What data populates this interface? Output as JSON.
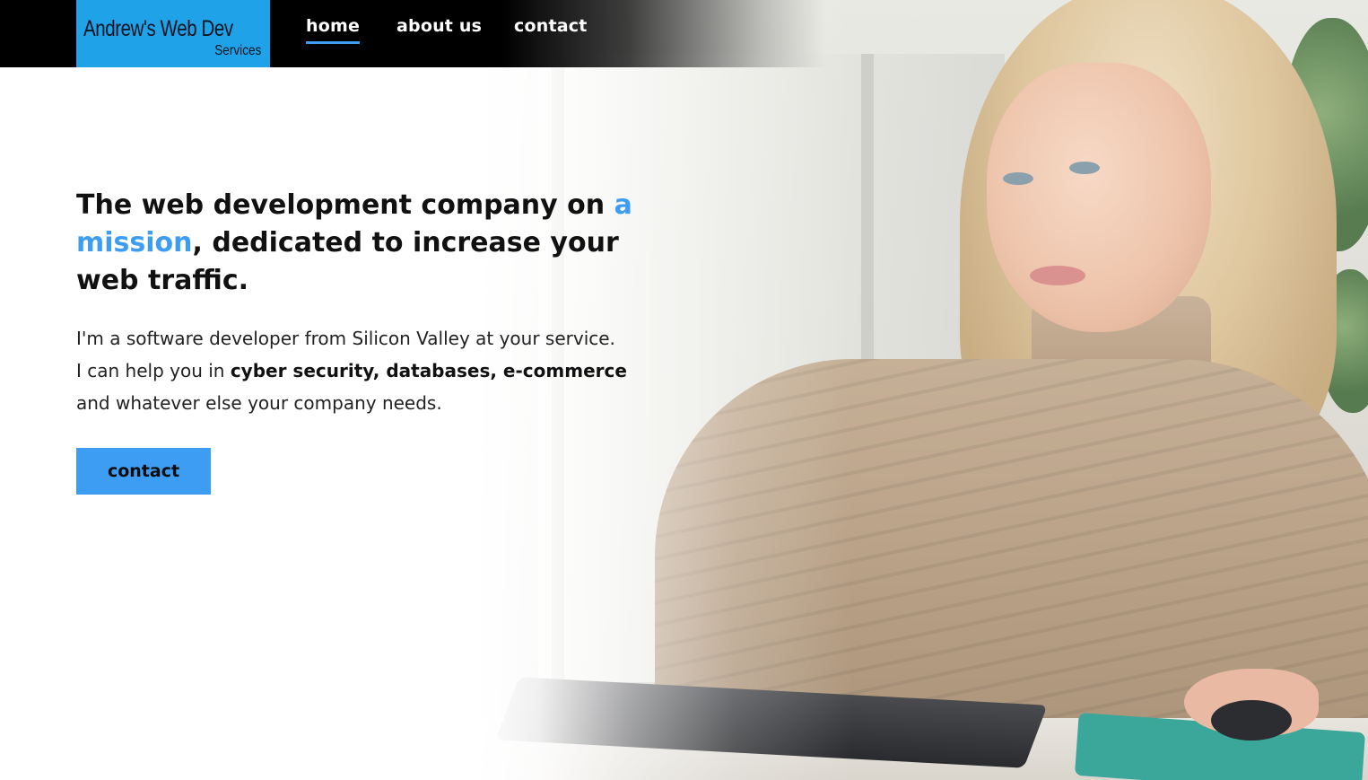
{
  "colors": {
    "accent": "#3d9df2",
    "logo_bg": "#1fa2e8",
    "navbar_bg": "#000000"
  },
  "logo": {
    "main": "Andrew's Web Dev",
    "sub": "Services"
  },
  "nav": {
    "items": [
      {
        "label": "home",
        "active": true
      },
      {
        "label": "about us",
        "active": false
      },
      {
        "label": "contact",
        "active": false
      }
    ]
  },
  "hero": {
    "heading_before": "The web development company on ",
    "heading_accent": "a mission",
    "heading_after": ", dedicated to increase your web traffic.",
    "line1": "I'm a software developer from Silicon Valley at your service.",
    "line2_prefix": "I can help you in ",
    "line2_bold": "cyber security, databases, e-commerce",
    "line3": "and whatever else your company needs.",
    "cta_label": "contact"
  },
  "background_image": {
    "icon": "woman-at-computer-photo"
  }
}
